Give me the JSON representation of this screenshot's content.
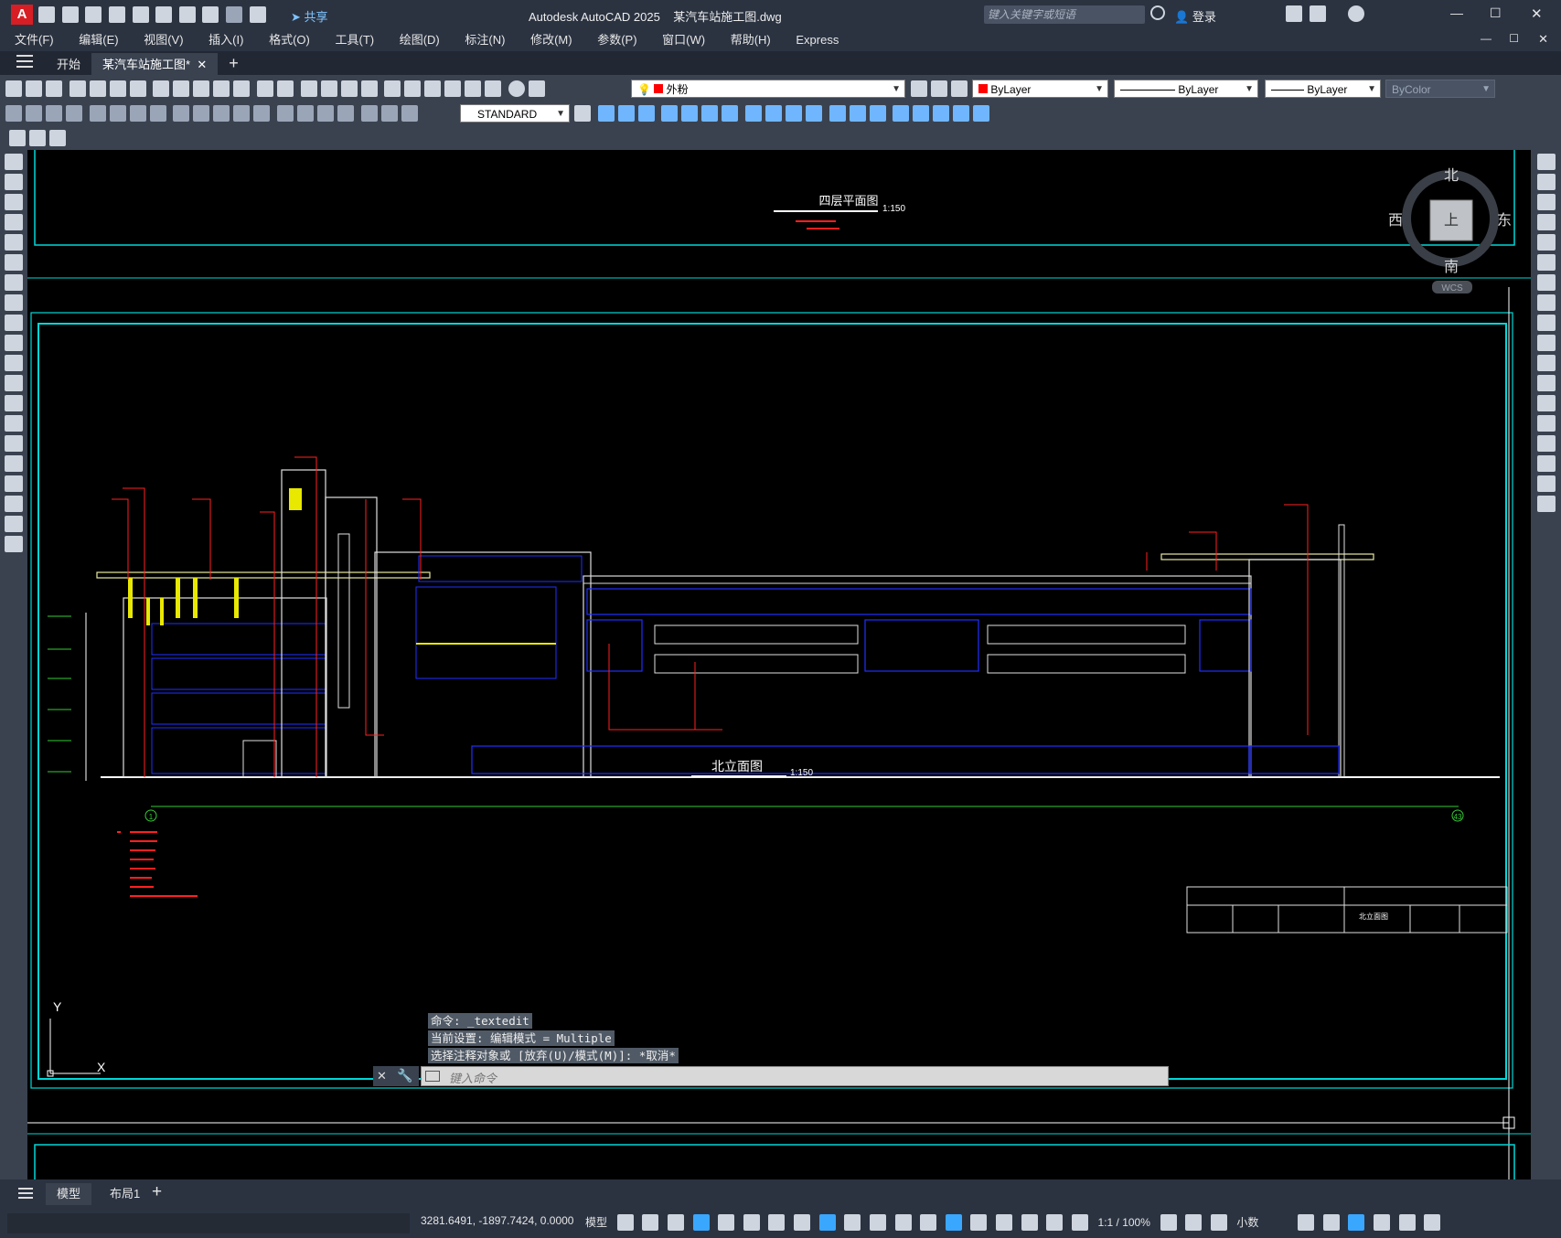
{
  "app": {
    "logo_letter": "A",
    "title": "Autodesk AutoCAD 2025",
    "document": "某汽车站施工图.dwg",
    "share_label": "共享",
    "search_placeholder": "键入关键字或短语",
    "login_label": "登录",
    "win_min": "—",
    "win_max": "☐",
    "win_close": "✕"
  },
  "menu": [
    "文件(F)",
    "编辑(E)",
    "视图(V)",
    "插入(I)",
    "格式(O)",
    "工具(T)",
    "绘图(D)",
    "标注(N)",
    "修改(M)",
    "参数(P)",
    "窗口(W)",
    "帮助(H)",
    "Express"
  ],
  "tabs": {
    "start": "开始",
    "active": "某汽车站施工图*",
    "close": "✕",
    "add": "+"
  },
  "toolbars": {
    "layer_value": "外粉",
    "color_value": "ByLayer",
    "linetype_value": "ByLayer",
    "lineweight_value": "ByLayer",
    "plotstyle_value": "ByColor",
    "textstyle_value": "STANDARD"
  },
  "viewcube": {
    "north": "北",
    "south": "南",
    "east": "东",
    "west": "西",
    "face": "上",
    "wcs": "WCS"
  },
  "drawing": {
    "top_title": "四层平面图",
    "top_scale": "1:150",
    "main_title": "北立面图",
    "main_scale": "1:150",
    "titleblock_label": "北立面图",
    "axis_left": "1",
    "axis_right": "43",
    "ucs_x": "X",
    "ucs_y": "Y"
  },
  "command": {
    "history": [
      "命令:  _textedit",
      "当前设置: 编辑模式 = Multiple",
      "选择注释对象或 [放弃(U)/模式(M)]: *取消*"
    ],
    "placeholder": "键入命令"
  },
  "layouts": {
    "model": "模型",
    "layout1": "布局1",
    "add": "+"
  },
  "status": {
    "coords": "3281.6491, -1897.7424, 0.0000",
    "model": "模型",
    "scale": "1:1 / 100%",
    "units": "小数"
  }
}
